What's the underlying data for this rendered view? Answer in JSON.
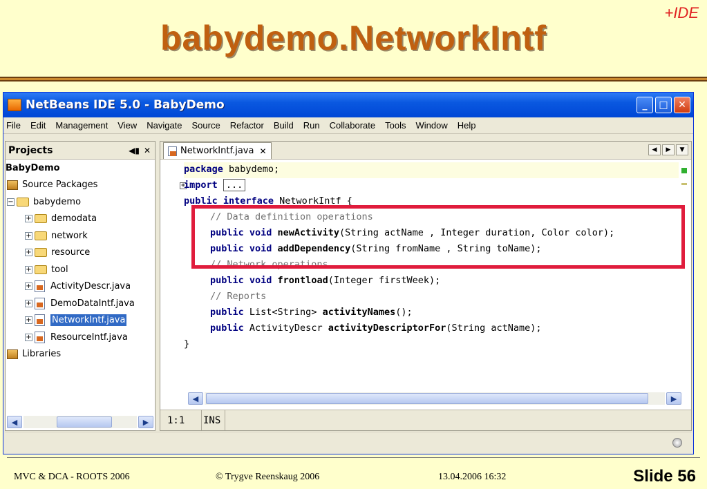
{
  "slide": {
    "tag": "+IDE",
    "title": "babydemo.NetworkIntf",
    "footer_left": "MVC & DCA -  ROOTS 2006",
    "footer_center": "© Trygve Reenskaug 2006",
    "footer_right": "13.04.2006 16:32",
    "slide_number": "Slide 56"
  },
  "window": {
    "title": "NetBeans IDE 5.0 - BabyDemo",
    "controls": [
      "minimize",
      "maximize",
      "close"
    ]
  },
  "menubar": {
    "items": [
      "File",
      "Edit",
      "Management",
      "View",
      "Navigate",
      "Source",
      "Refactor",
      "Build",
      "Run",
      "Collaborate",
      "Tools",
      "Window",
      "Help"
    ]
  },
  "projects": {
    "title": "Projects",
    "tree": [
      {
        "label": "BabyDemo",
        "level": 0,
        "icon": "project-root"
      },
      {
        "label": "Source Packages",
        "level": 1,
        "icon": "package-icon"
      },
      {
        "label": "babydemo",
        "level": 1,
        "icon": "folder-icon",
        "expanded": true
      },
      {
        "label": "demodata",
        "level": 2,
        "icon": "folder-icon"
      },
      {
        "label": "network",
        "level": 2,
        "icon": "folder-icon"
      },
      {
        "label": "resource",
        "level": 2,
        "icon": "folder-icon"
      },
      {
        "label": "tool",
        "level": 2,
        "icon": "folder-icon"
      },
      {
        "label": "ActivityDescr.java",
        "level": 2,
        "icon": "java-file-icon"
      },
      {
        "label": "DemoDataIntf.java",
        "level": 2,
        "icon": "java-file-icon"
      },
      {
        "label": "NetworkIntf.java",
        "level": 2,
        "icon": "java-file-icon",
        "selected": true
      },
      {
        "label": "ResourceIntf.java",
        "level": 2,
        "icon": "java-file-icon"
      },
      {
        "label": "Libraries",
        "level": 1,
        "icon": "library-icon"
      }
    ]
  },
  "editor": {
    "tab_label": "NetworkIntf.java",
    "code": {
      "line1": {
        "kw": "package",
        "rest": " babydemo;"
      },
      "line2": {
        "kw": "import",
        "rest": "..."
      },
      "line3": {
        "kw": "public interface",
        "rest": " NetworkIntf {"
      },
      "line4": {
        "comment": "// Data definition operations"
      },
      "line5": {
        "kw": "public void",
        "name": "newActivity",
        "rest": "(String actName , Integer duration, Color color);"
      },
      "line6": {
        "kw": "public void",
        "name": "addDependency",
        "rest": "(String fromName , String toName);"
      },
      "line7": {
        "comment": "// Network operations"
      },
      "line8": {
        "kw": "public void",
        "name": "frontload",
        "rest": "(Integer firstWeek);"
      },
      "line9": {
        "comment": "// Reports"
      },
      "line10": {
        "kw": "public",
        "type": " List<String> ",
        "name": "activityNames",
        "rest": "();"
      },
      "line11": {
        "kw": "public",
        "type": " ActivityDescr ",
        "name": "activityDescriptorFor",
        "rest": "(String actName);"
      },
      "line12": {
        "text": "}"
      }
    },
    "status": {
      "position": "1:1",
      "mode": "INS"
    }
  },
  "colors": {
    "highlight": "#e01c3c",
    "title": "#c06010",
    "selection": "#316ac5"
  }
}
